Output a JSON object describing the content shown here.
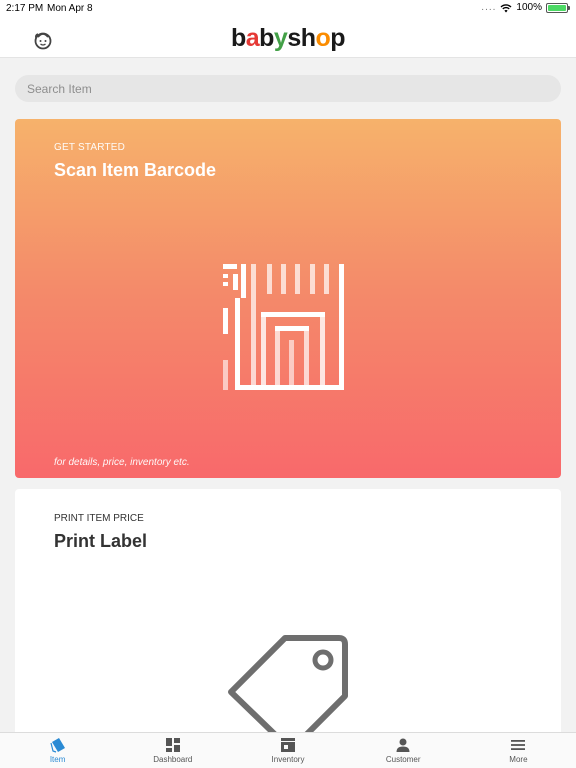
{
  "status_bar": {
    "time": "2:17 PM",
    "date": "Mon Apr 8",
    "signal_dots": "....",
    "battery": "100%"
  },
  "header": {
    "logo_letters": [
      "b",
      "a",
      "b",
      "y",
      "s",
      "h",
      "o",
      "p"
    ],
    "logo_colors": [
      "#1a1a1a",
      "#e53935",
      "#1a1a1a",
      "#43a047",
      "#1a1a1a",
      "#1a1a1a",
      "#fb8c00",
      "#1a1a1a"
    ],
    "left_icon": "baby-face-icon"
  },
  "search": {
    "placeholder": "Search Item"
  },
  "scan_card": {
    "eyebrow": "GET STARTED",
    "title": "Scan Item Barcode",
    "hint": "for details, price, inventory etc.",
    "icon": "barcode-icon",
    "gradient": [
      "#f6b26b",
      "#f8696b"
    ]
  },
  "print_card": {
    "eyebrow": "PRINT ITEM PRICE",
    "title": "Print Label",
    "icon": "price-tag-icon"
  },
  "tabs": [
    {
      "label": "Item",
      "icon": "tag-icon",
      "active": true
    },
    {
      "label": "Dashboard",
      "icon": "dashboard-icon",
      "active": false
    },
    {
      "label": "Inventory",
      "icon": "store-icon",
      "active": false
    },
    {
      "label": "Customer",
      "icon": "person-icon",
      "active": false
    },
    {
      "label": "More",
      "icon": "menu-icon",
      "active": false
    }
  ],
  "colors": {
    "accent": "#2a8ad4",
    "tab_inactive": "#555555"
  }
}
